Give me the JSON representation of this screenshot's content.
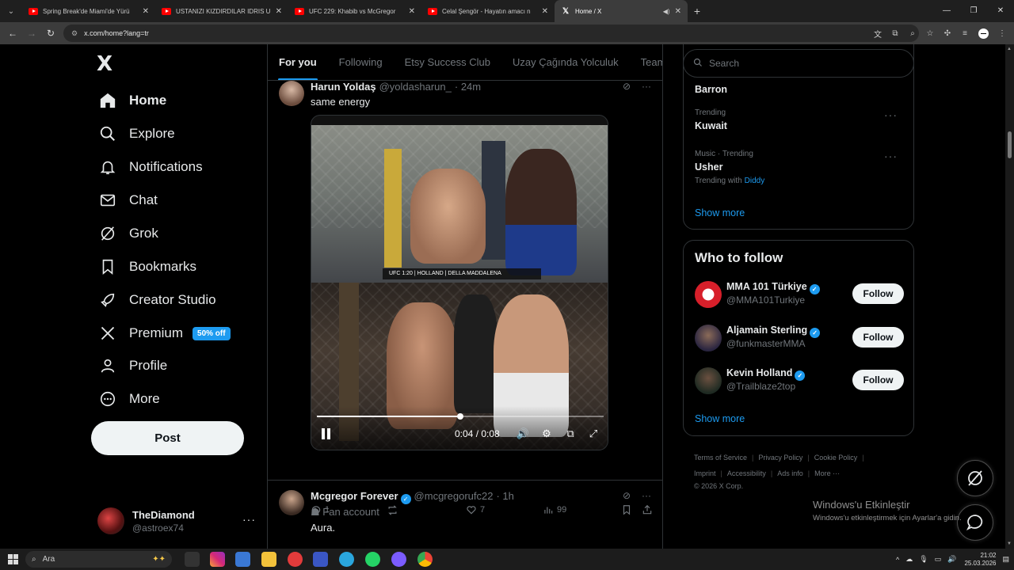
{
  "browser": {
    "tabs": [
      {
        "title": "Spring Break'de Miami'de Yürü",
        "kind": "youtube"
      },
      {
        "title": "USTANIZI KIZDIRDILAR IDRIS U",
        "kind": "youtube"
      },
      {
        "title": "UFC 229: Khabib vs McGregor",
        "kind": "youtube"
      },
      {
        "title": "Celal Şengör - Hayatın amacı n",
        "kind": "youtube"
      },
      {
        "title": "Home / X",
        "kind": "x",
        "active": true
      }
    ],
    "url": "x.com/home?lang=tr"
  },
  "nav": {
    "logo": "X",
    "items": [
      {
        "label": "Home",
        "icon": "home-icon"
      },
      {
        "label": "Explore",
        "icon": "search-icon"
      },
      {
        "label": "Notifications",
        "icon": "bell-icon"
      },
      {
        "label": "Chat",
        "icon": "envelope-icon"
      },
      {
        "label": "Grok",
        "icon": "grok-icon"
      },
      {
        "label": "Bookmarks",
        "icon": "bookmark-icon"
      },
      {
        "label": "Creator Studio",
        "icon": "rocket-icon"
      },
      {
        "label": "Premium",
        "icon": "x-icon"
      },
      {
        "label": "Profile",
        "icon": "person-icon"
      },
      {
        "label": "More",
        "icon": "more-circle-icon"
      }
    ],
    "premium_badge": "50% off",
    "post_label": "Post",
    "account": {
      "name": "TheDiamond",
      "handle": "@astroex74"
    }
  },
  "feed": {
    "tabs": [
      "For you",
      "Following",
      "Etsy Success Club",
      "Uzay Çağında Yolculuk",
      "Team M"
    ],
    "tweet1": {
      "name": "Harun Yoldaş",
      "handle": "@yoldasharun_",
      "time": "· 24m",
      "text": "same energy",
      "video": {
        "time": "0:04 / 0:08",
        "progress": 0.5,
        "ticker": "UFC 1:20 | HOLLAND | DELLA MADDALENA"
      },
      "replies": "1",
      "likes": "7",
      "views": "99"
    },
    "tweet2": {
      "name": "Mcgregor Forever",
      "handle": "@mcgregorufc22",
      "time": "· 1h",
      "badge": "Fan account",
      "text": "Aura."
    }
  },
  "sidebar": {
    "search_placeholder": "Search",
    "trends": [
      {
        "meta": "",
        "name": "Barron"
      },
      {
        "meta": "Trending",
        "name": "Kuwait"
      },
      {
        "meta": "Music · Trending",
        "name": "Usher",
        "with_label": "Trending with",
        "with": "Diddy"
      }
    ],
    "show_more": "Show more",
    "who_to_follow": {
      "title": "Who to follow",
      "accounts": [
        {
          "name": "MMA 101 Türkiye",
          "handle": "@MMA101Turkiye"
        },
        {
          "name": "Aljamain Sterling",
          "handle": "@funkmasterMMA"
        },
        {
          "name": "Kevin Holland",
          "handle": "@Trailblaze2top"
        }
      ],
      "follow_label": "Follow",
      "show_more": "Show more"
    },
    "footer": [
      "Terms of Service",
      "Privacy Policy",
      "Cookie Policy",
      "Imprint",
      "Accessibility",
      "Ads info",
      "More ···",
      "© 2026 X Corp."
    ]
  },
  "watermark": {
    "line1": "Windows'u Etkinleştir",
    "line2": "Windows'u etkinleştirmek için Ayarlar'a gidin."
  },
  "taskbar": {
    "search": "Ara",
    "time": "21:02",
    "date": "25.03.2026"
  },
  "colors": {
    "accent": "#1d9bf0",
    "background": "#000000",
    "border": "#2f3336"
  }
}
